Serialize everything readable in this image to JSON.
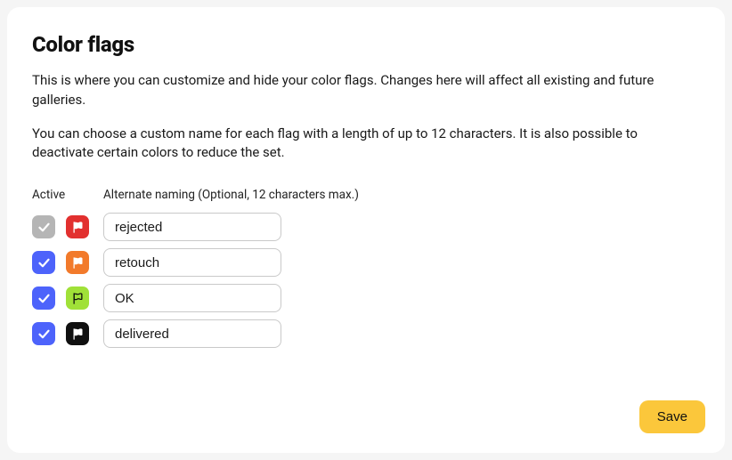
{
  "title": "Color flags",
  "description_1": "This is where you can customize and hide your color flags. Changes here will affect all existing and future galleries.",
  "description_2": "You can choose a custom name for each flag with a length of up to 12 characters. It is also possible to deactivate certain colors to reduce the set.",
  "headers": {
    "active": "Active",
    "alternate": "Alternate naming (Optional, 12 characters max.)"
  },
  "flags": [
    {
      "active": false,
      "color_class": "flag-red",
      "color_name": "red",
      "stroke": "#ffffff",
      "fill": "#ffffff",
      "name": "rejected"
    },
    {
      "active": true,
      "color_class": "flag-orange",
      "color_name": "orange",
      "stroke": "#ffffff",
      "fill": "#ffffff",
      "name": "retouch"
    },
    {
      "active": true,
      "color_class": "flag-green",
      "color_name": "green",
      "stroke": "#0a0a0a",
      "fill": "none",
      "name": "OK"
    },
    {
      "active": true,
      "color_class": "flag-black",
      "color_name": "black",
      "stroke": "#ffffff",
      "fill": "#ffffff",
      "name": "delivered"
    }
  ],
  "save_label": "Save"
}
